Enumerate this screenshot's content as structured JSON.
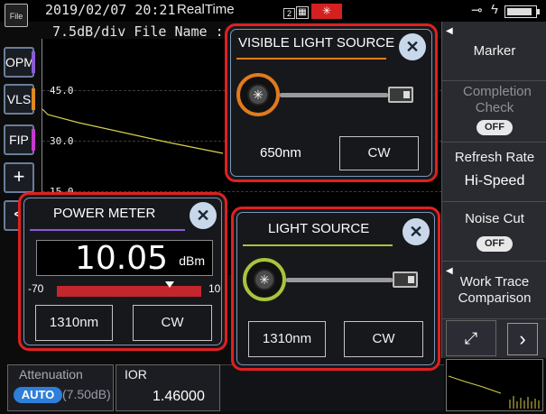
{
  "status_bar": {
    "file_icon_label": "File",
    "datetime": "2019/02/07 20:21",
    "mode": "RealTime",
    "channel": "2",
    "laser_badge": "✳",
    "battery_level": 0.9
  },
  "trace_header": {
    "scale": "7.5dB/div",
    "file_name_label": "File Name :"
  },
  "left_tools": [
    {
      "label": "OPM",
      "accent": "#8a5bd4"
    },
    {
      "label": "VLS",
      "accent": "#e08a1e"
    },
    {
      "label": "FIP",
      "accent": "#c83ad0"
    },
    {
      "label": "+"
    },
    {
      "label": "<"
    }
  ],
  "graph": {
    "y_ticks": [
      "45.0",
      "30.0",
      "15.0"
    ],
    "trace_color": "#d8d04a"
  },
  "right_menu": {
    "marker": "Marker",
    "completion_check": "Completion Check",
    "completion_check_state": "OFF",
    "refresh_rate": "Refresh Rate",
    "refresh_rate_value": "Hi-Speed",
    "noise_cut": "Noise Cut",
    "noise_cut_state": "OFF",
    "work_trace": "Work Trace Comparison"
  },
  "bottom": {
    "attenuation_title": "Attenuation",
    "attenuation_mode": "AUTO",
    "attenuation_value": "(7.50dB)",
    "ior_title": "IOR",
    "ior_value": "1.46000"
  },
  "vls_popup": {
    "title": "VISIBLE LIGHT SOURCE",
    "accent": "#e07b1e",
    "wavelength": "650nm",
    "mode_button": "CW"
  },
  "ls_popup": {
    "title": "LIGHT SOURCE",
    "accent": "#a8c43a",
    "wavelength_button": "1310nm",
    "mode_button": "CW"
  },
  "pm_popup": {
    "title": "POWER METER",
    "value": "10.05",
    "unit": "dBm",
    "scale_min": "-70",
    "scale_max": "10",
    "level_fraction": 0.78,
    "wavelength_button": "1310nm",
    "mode_button": "CW"
  },
  "colors": {
    "popup_border": "#e02020",
    "panel_bg": "#2a2b31",
    "auto_badge": "#2e7fd9"
  }
}
